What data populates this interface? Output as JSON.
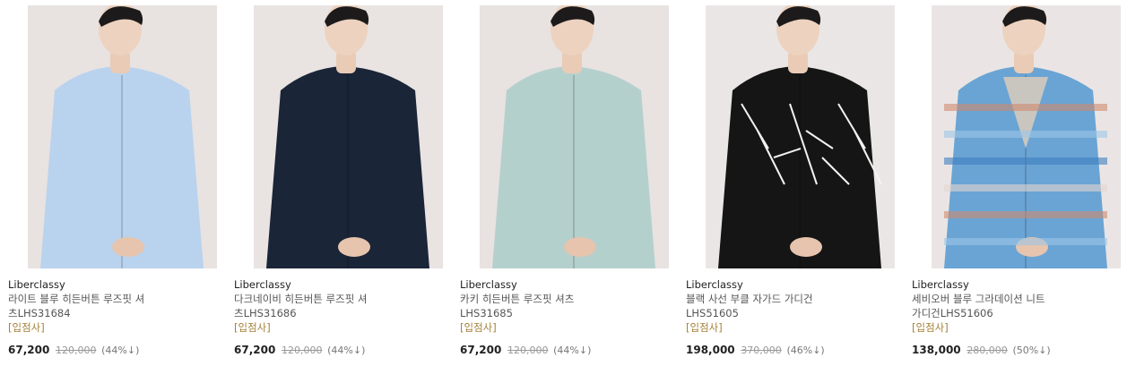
{
  "products": [
    {
      "brand": "Liberclassy",
      "name_line1": "라이트 블루 히든버튼 루즈핏 셔",
      "name_line2": "츠LHS31684",
      "tag": "[입점사]",
      "price": "67,200",
      "original_price": "120,000",
      "discount": "(44%↓)",
      "garment_color": "#b9d3ee",
      "bg_color": "#e8e2e1",
      "image_icon": "model-wearing-shirt-icon"
    },
    {
      "brand": "Liberclassy",
      "name_line1": "다크네이비 히든버튼 루즈핏 셔",
      "name_line2": "츠LHS31686",
      "tag": "[입점사]",
      "price": "67,200",
      "original_price": "120,000",
      "discount": "(44%↓)",
      "garment_color": "#1b2538",
      "bg_color": "#e9e3e2",
      "image_icon": "model-wearing-shirt-icon"
    },
    {
      "brand": "Liberclassy",
      "name_line1": "카키 히든버튼 루즈핏 셔츠",
      "name_line2": "LHS31685",
      "tag": "[입점사]",
      "price": "67,200",
      "original_price": "120,000",
      "discount": "(44%↓)",
      "garment_color": "#b4d0cd",
      "bg_color": "#e8e2e1",
      "image_icon": "model-wearing-shirt-icon"
    },
    {
      "brand": "Liberclassy",
      "name_line1": "블랙 사선 부클 자가드 가디건",
      "name_line2": "LHS51605",
      "tag": "[입점사]",
      "price": "198,000",
      "original_price": "370,000",
      "discount": "(46%↓)",
      "garment_color": "#151515",
      "bg_color": "#ebe6e6",
      "image_icon": "model-wearing-cardigan-icon"
    },
    {
      "brand": "Liberclassy",
      "name_line1": "세비오버 블루 그라데이션 니트",
      "name_line2": "가디건LHS51606",
      "tag": "[입점사]",
      "price": "138,000",
      "original_price": "280,000",
      "discount": "(50%↓)",
      "garment_color": "#6aa4d4",
      "bg_color": "#eae5e4",
      "image_icon": "model-wearing-cardigan-icon"
    }
  ]
}
